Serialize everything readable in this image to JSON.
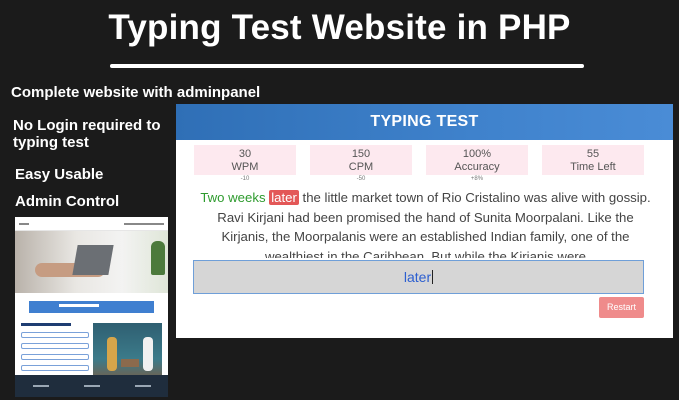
{
  "banner": {
    "title": "Typing Test Website in PHP"
  },
  "features": [
    "Complete website with adminpanel",
    "No Login required to typing test",
    "Easy Usable",
    "Admin Control"
  ],
  "app": {
    "header": "TYPING TEST",
    "stats": [
      {
        "value": "30",
        "label": "WPM",
        "sub": "-10"
      },
      {
        "value": "150",
        "label": "CPM",
        "sub": "-50"
      },
      {
        "value": "100%",
        "label": "Accuracy",
        "sub": "+8%"
      },
      {
        "value": "55",
        "label": "Time Left",
        "sub": ""
      }
    ],
    "passage": {
      "typed": "Two weeks ",
      "current": "later",
      "rest": " the little market town of Rio Cristalino was alive with gossip. Ravi Kirjani had been promised the hand of Sunita Moorpalani. Like the Kirjanis, the Moorpalanis were an established Indian family, one of the wealthiest in the Caribbean. But while the Kirjanis were"
    },
    "input_value": "later",
    "restart_label": "Restart"
  },
  "colors": {
    "header_blue": "#3f82cc",
    "typed_green": "#2e9b2e",
    "current_red": "#e35757",
    "stat_bg": "#fde9ef",
    "restart_bg": "#ef8b8b"
  }
}
